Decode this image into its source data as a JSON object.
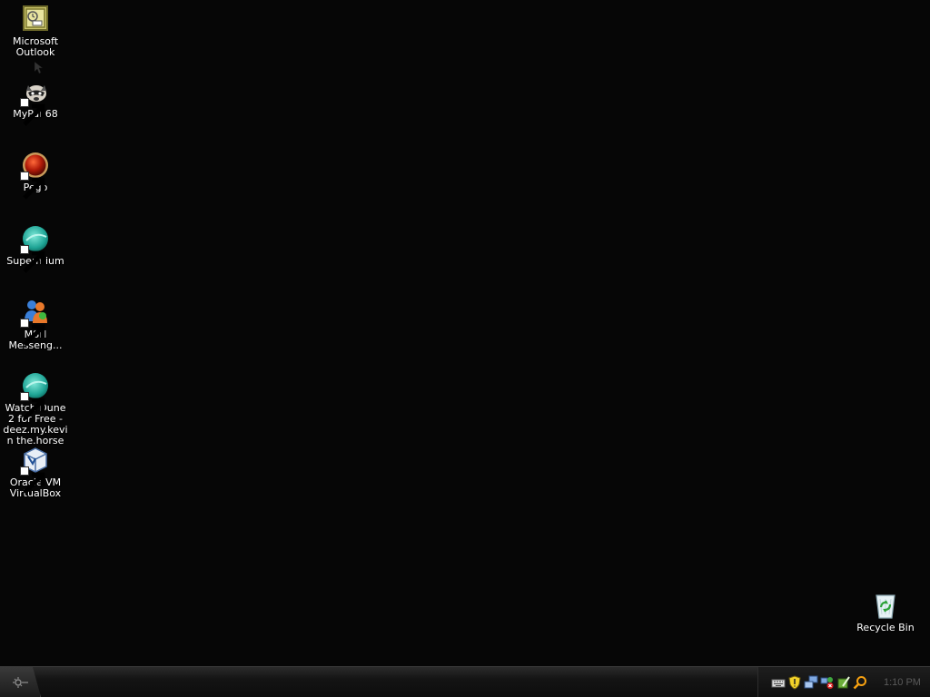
{
  "desktop": {
    "icons": [
      {
        "label": "Microsoft Outlook",
        "icon": "outlook-icon",
        "shortcut": false
      },
      {
        "label": "MyPal 68",
        "icon": "mypal-icon",
        "shortcut": true
      },
      {
        "label": "Pego",
        "icon": "pego-icon",
        "shortcut": true
      },
      {
        "label": "Supermium",
        "icon": "supermium-icon",
        "shortcut": true
      },
      {
        "label": "MSN Messeng...",
        "icon": "msn-messenger-icon",
        "shortcut": true
      },
      {
        "label": "Watch Dune 2 for Free - deez.my.kevin the.horse",
        "icon": "browser-icon",
        "shortcut": true
      },
      {
        "label": "Oracle VM VirtualBox",
        "icon": "virtualbox-icon",
        "shortcut": true
      }
    ],
    "recycle_bin": {
      "label": "Recycle Bin",
      "icon": "recycle-bin-icon"
    }
  },
  "taskbar": {
    "start_icon": "start-orb-icon",
    "tray_icons": [
      "keyboard-icon",
      "security-shield-icon",
      "network-icon",
      "network-status-icon",
      "update-icon",
      "search-icon"
    ],
    "clock": "1:10 PM"
  },
  "colors": {
    "desktop_background": "#060606",
    "taskbar": "#141414",
    "label_text": "#ffffff",
    "clock_text": "#5a5a5a"
  }
}
